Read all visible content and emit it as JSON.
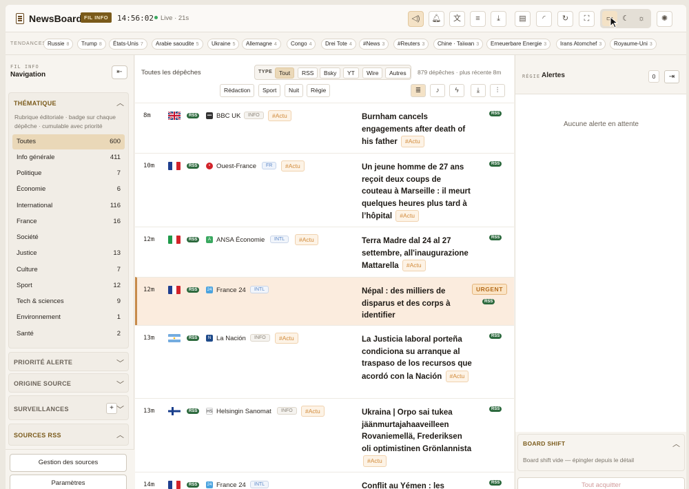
{
  "header": {
    "brand": "NewsBoard",
    "badge": "FIL INFO",
    "clock": "14:56:02",
    "live": "Live · 21s",
    "icons": [
      "sound-icon",
      "bell-icon",
      "translate-icon",
      "menu-icon",
      "download-icon",
      "document-icon",
      "rss-icon",
      "refresh-icon",
      "fullscreen-icon",
      "monitor-icon",
      "moon-icon",
      "sun-icon",
      "settings-sun-icon"
    ]
  },
  "tags": {
    "label": "TENDANCES",
    "items": [
      {
        "label": "Russie",
        "count": "8"
      },
      {
        "label": "Trump",
        "count": "8"
      },
      {
        "label": "États-Unis",
        "count": "7"
      },
      {
        "label": "Arabie saoudite",
        "count": "5"
      },
      {
        "label": "Ukraine",
        "count": "5"
      },
      {
        "label": "Allemagne",
        "count": "4"
      },
      {
        "label": "Congo",
        "count": "4"
      },
      {
        "label": "Drei Tote",
        "count": "4"
      },
      {
        "label": "#News",
        "count": "3"
      },
      {
        "label": "#Reuters",
        "count": "3"
      },
      {
        "label": "Chine · Taïwan",
        "count": "3"
      },
      {
        "label": "Erneuerbare Energie",
        "count": "3"
      },
      {
        "label": "Irans Atomchef",
        "count": "3"
      },
      {
        "label": "Royaume-Uni",
        "count": "3"
      }
    ]
  },
  "left": {
    "kicker": "FIL INFO",
    "title": "Navigation",
    "thematique": {
      "title": "THÉMATIQUE",
      "desc": "Rubrique éditoriale · badge sur chaque dépêche · cumulable avec priorité",
      "items": [
        {
          "label": "Toutes",
          "count": "600"
        },
        {
          "label": "Info générale",
          "count": "411"
        },
        {
          "label": "Politique",
          "count": "7"
        },
        {
          "label": "Économie",
          "count": "6"
        },
        {
          "label": "International",
          "count": "116"
        },
        {
          "label": "France",
          "count": "16"
        },
        {
          "label": "Société",
          "count": ""
        },
        {
          "label": "Justice",
          "count": "13"
        },
        {
          "label": "Culture",
          "count": "7"
        },
        {
          "label": "Sport",
          "count": "12"
        },
        {
          "label": "Tech & sciences",
          "count": "9"
        },
        {
          "label": "Environnement",
          "count": "1"
        },
        {
          "label": "Santé",
          "count": "2"
        }
      ]
    },
    "sections": [
      "PRIORITÉ ALERTE",
      "ORIGINE SOURCE",
      "SURVEILLANCES",
      "SOURCES RSS"
    ],
    "plus": "+",
    "buttons": [
      "Gestion des sources",
      "Paramètres"
    ]
  },
  "middle": {
    "title": "Toutes les dépêches",
    "type_label": "TYPE",
    "types": [
      "Tout",
      "RSS",
      "Bsky",
      "YT",
      "Wire",
      "Autres"
    ],
    "count": "879 dépêches · plus récente 8m",
    "cats": [
      "Rédaction",
      "Sport",
      "Nuit",
      "Régie"
    ],
    "rows": [
      {
        "time": "8m",
        "flag": "uk",
        "source": "BBC UK",
        "badge": "INFO",
        "badge_type": "info",
        "tag": "#Actu",
        "title": "Burnham cancels engagements after death of his father",
        "urgent": ""
      },
      {
        "time": "10m",
        "flag": "fr",
        "source": "Ouest-France",
        "badge": "FR",
        "badge_type": "fr",
        "tag": "#Actu",
        "title": "Un jeune homme de 27 ans reçoit deux coups de couteau à Marseille : il meurt quelques heures plus tard à l’hôpital",
        "urgent": ""
      },
      {
        "time": "12m",
        "flag": "it",
        "source": "ANSA Économie",
        "badge": "INTL",
        "badge_type": "intl",
        "tag": "#Actu",
        "title": "Terra Madre dal 24 al 27 settembre, all'inaugurazione Mattarella",
        "urgent": ""
      },
      {
        "time": "12m",
        "flag": "fr",
        "source": "France 24",
        "badge": "INTL",
        "badge_type": "intl",
        "tag": "",
        "title": "Népal : des milliers de disparus et des corps à identifier",
        "urgent": "URGENT"
      },
      {
        "time": "13m",
        "flag": "ar",
        "source": "La Nación",
        "badge": "INFO",
        "badge_type": "info",
        "tag": "#Actu",
        "title": "La Justicia laboral porteña condiciona su arranque al traspaso de los recursos que acordó con la Nación",
        "urgent": ""
      },
      {
        "time": "13m",
        "flag": "fi",
        "source": "Helsingin Sanomat",
        "badge": "INFO",
        "badge_type": "info",
        "tag": "#Actu",
        "title": "Ukraina | Orpo sai tukea jäänmurtajahaaveilleen Rovaniemellä, Frederiksen oli optimistinen Grönlannista",
        "urgent": ""
      },
      {
        "time": "14m",
        "flag": "fr",
        "source": "France 24",
        "badge": "INTL",
        "badge_type": "intl",
        "tag": "",
        "title": "Conflit au Yémen : les",
        "urgent": ""
      }
    ],
    "rss": "RSS"
  },
  "right": {
    "kicker": "RÉGIE",
    "title": "Alertes",
    "count": "0",
    "empty": "Aucune alerte en attente",
    "boardshift_title": "BOARD SHIFT",
    "boardshift_desc": "Board shift vide — épingler depuis le détail",
    "ack": "Tout acquitter"
  },
  "colors": {
    "accent": "#7a5a1a",
    "highlight": "#fbecde",
    "rss": "#2d6a3e",
    "tag": "#d18a3a"
  }
}
